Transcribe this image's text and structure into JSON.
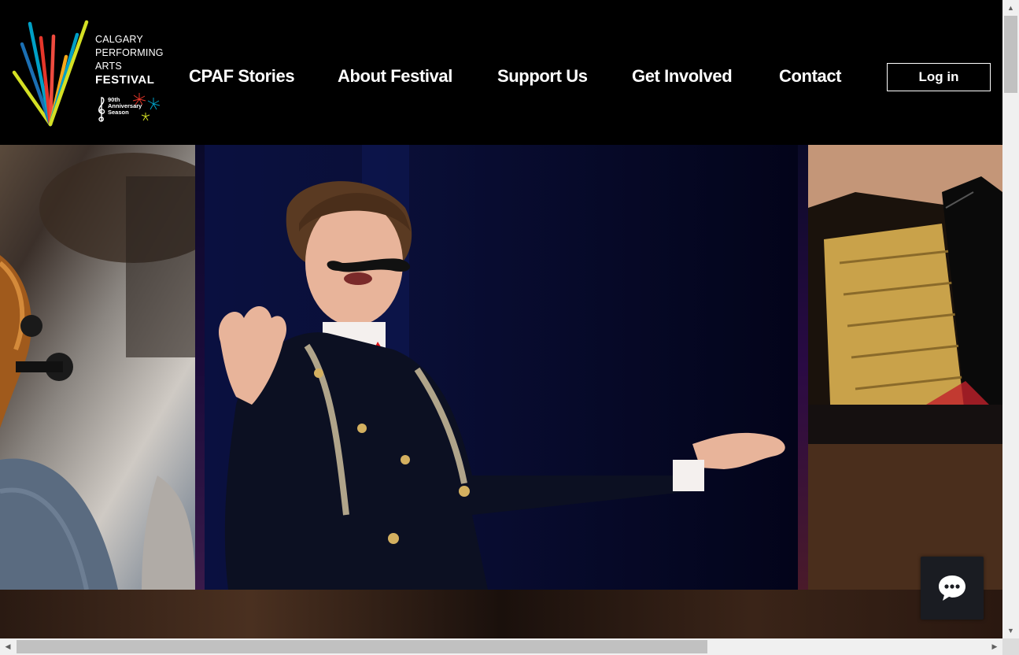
{
  "logo": {
    "line1": "CALGARY",
    "line2": "PERFORMING",
    "line3": "ARTS",
    "line4": "FESTIVAL",
    "anniv1": "90th",
    "anniv2": "Anniversary",
    "anniv3": "Season",
    "colors": [
      "#00a0c6",
      "#e6362a",
      "#f7a81b",
      "#d4e024",
      "#1b6fb3",
      "#ef4b3f"
    ]
  },
  "nav": {
    "items": [
      {
        "label": "CPAF Stories"
      },
      {
        "label": "About Festival"
      },
      {
        "label": "Support Us"
      },
      {
        "label": "Get Involved"
      },
      {
        "label": "Contact"
      }
    ],
    "login_label": "Log in"
  },
  "gallery": {
    "photos": [
      "cello-photo",
      "performer-photo",
      "piano-photo"
    ]
  },
  "chat": {
    "icon": "chat-bubble-icon"
  },
  "colors": {
    "background": "#000000",
    "text": "#ffffff",
    "chat_bg": "#1a1c22"
  }
}
